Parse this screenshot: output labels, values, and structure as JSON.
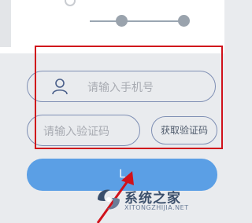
{
  "form": {
    "phone_placeholder": "请输入手机号",
    "code_placeholder": "请输入验证码",
    "get_code_label": "获取验证码",
    "login_label": "L"
  },
  "steps": {
    "active_count": 2
  },
  "watermark": {
    "title": "系统之家",
    "subtitle": "XITONGZHIJIA.NET"
  },
  "colors": {
    "accent": "#5b9fe5",
    "annotation": "#d0121b",
    "input_border": "#7f8fb4",
    "placeholder": "#a8abb2"
  },
  "icons": {
    "phone_field": "user-icon"
  }
}
